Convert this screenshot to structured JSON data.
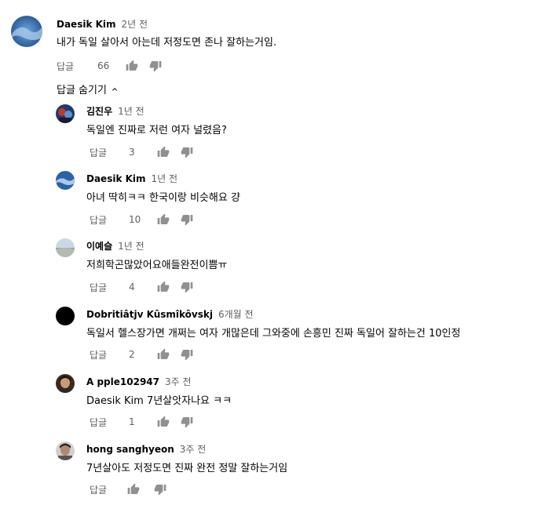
{
  "top_comment": {
    "author": "Daesik Kim",
    "time": "2년 전",
    "text": "내가 독일 살아서 아는데 저정도면 존나 잘하는거임.",
    "reply_label": "답글",
    "likes": "66"
  },
  "replies_toggle": {
    "label": "답글 숨기기"
  },
  "replies": [
    {
      "author": "김진우",
      "time": "1년 전",
      "text": "독일엔 진짜로 저런 여자 널렸음?",
      "reply_label": "답글",
      "likes": "3"
    },
    {
      "author": "Daesik Kim",
      "time": "1년 전",
      "text": "아녀 딱히ㅋㅋ 한국이랑 비슷해요 걍",
      "reply_label": "답글",
      "likes": "10"
    },
    {
      "author": "이예슬",
      "time": "1년 전",
      "text": "저희학곤많았어요애들완전이쁨ㅠ",
      "reply_label": "답글",
      "likes": "4"
    },
    {
      "author": "Dobritiâtjv Kûsmîkôvskj",
      "time": "6개월 전",
      "text": "독일서 헬스장가면 개쩌는 여자 개많은데 그와중에 손흥민 진짜 독일어 잘하는건 10인정",
      "reply_label": "답글",
      "likes": "2"
    },
    {
      "author": "A pple102947",
      "time": "3주 전",
      "text": "Daesik Kim 7년살앗자나요 ㅋㅋ",
      "reply_label": "답글",
      "likes": "1"
    },
    {
      "author": "hong sanghyeon",
      "time": "3주 전",
      "text": "7년살아도 저정도면 진짜 완전 정말 잘하는거임",
      "reply_label": "답글",
      "likes": ""
    }
  ],
  "colors": {
    "text": "#030303",
    "meta": "#606060",
    "icon": "#909090"
  },
  "icons": {
    "like": "thumb-up-icon",
    "dislike": "thumb-down-icon",
    "toggle": "chevron-up-icon"
  }
}
